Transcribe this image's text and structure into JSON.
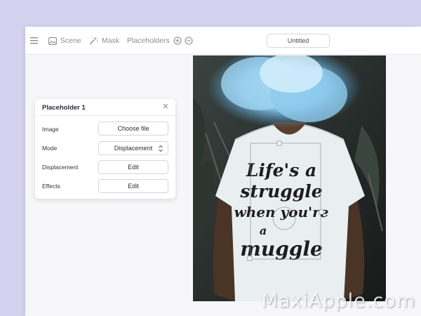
{
  "toolbar": {
    "menu_icon": "hamburger-menu-icon",
    "scene_label": "Scene",
    "mask_label": "Mask",
    "placeholders_label": "Placeholders",
    "document_title": "Untitled"
  },
  "panel": {
    "title": "Placeholder 1",
    "rows": [
      {
        "label": "Image",
        "button": "Choose file"
      },
      {
        "label": "Mode",
        "button": "Displacement"
      },
      {
        "label": "Displacement",
        "button": "Edit"
      },
      {
        "label": "Effects",
        "button": "Edit"
      }
    ]
  },
  "canvas": {
    "shirt_text": [
      "Life's a",
      "struggle",
      "when you're",
      "a",
      "muggle"
    ]
  },
  "watermark": "MaxiApple.com",
  "colors": {
    "background": "#d4d2ef",
    "smoke": "#7fc3e8",
    "shirt": "#e9eef0"
  }
}
